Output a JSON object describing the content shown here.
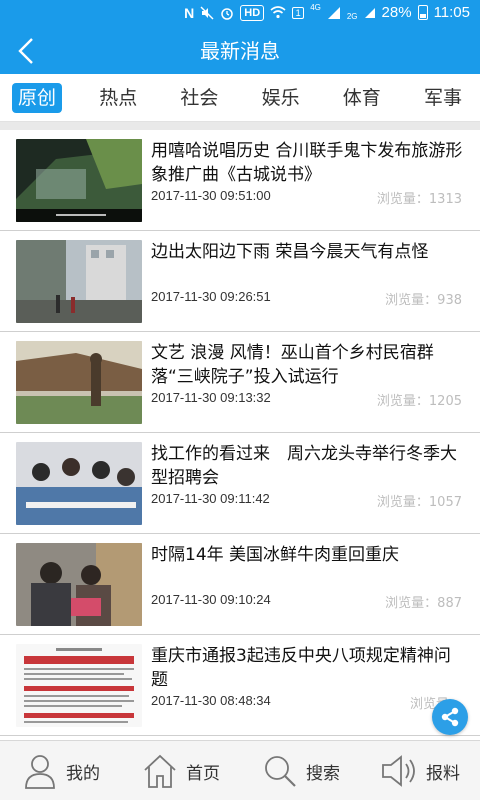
{
  "status_bar": {
    "hd_label": "HD",
    "sim_label": "1",
    "network_4g": "4G",
    "network_2g": "2G",
    "battery_percent": "28%",
    "time": "11:05"
  },
  "header": {
    "title": "最新消息",
    "back_icon": "chevron-left-icon"
  },
  "tabs": [
    {
      "label": "原创",
      "active": true
    },
    {
      "label": "热点",
      "active": false
    },
    {
      "label": "社会",
      "active": false
    },
    {
      "label": "娱乐",
      "active": false
    },
    {
      "label": "体育",
      "active": false
    },
    {
      "label": "军事",
      "active": false
    }
  ],
  "news": [
    {
      "title": "用嘻哈说唱历史 合川联手鬼卞发布旅游形象推广曲《古城说书》",
      "date": "2017-11-30 09:51:00",
      "views": "浏览量：1313"
    },
    {
      "title": "边出太阳边下雨 荣昌今晨天气有点怪",
      "date": "2017-11-30 09:26:51",
      "views": "浏览量：938"
    },
    {
      "title": "文艺 浪漫 风情！巫山首个乡村民宿群落“三峡院子”投入试运行",
      "date": "2017-11-30 09:13:32",
      "views": "浏览量：1205"
    },
    {
      "title": "找工作的看过来　周六龙头寺举行冬季大型招聘会",
      "date": "2017-11-30 09:11:42",
      "views": "浏览量：1057"
    },
    {
      "title": "时隔14年 美国冰鲜牛肉重回重庆",
      "date": "2017-11-30 09:10:24",
      "views": "浏览量：887"
    },
    {
      "title": "重庆市通报3起违反中央八项规定精神问题",
      "date": "2017-11-30 08:48:34",
      "views": "浏览量："
    }
  ],
  "bottom_nav": [
    {
      "label": "我的",
      "icon": "user-icon"
    },
    {
      "label": "首页",
      "icon": "home-icon"
    },
    {
      "label": "搜索",
      "icon": "search-icon"
    },
    {
      "label": "报料",
      "icon": "speaker-icon"
    }
  ],
  "colors": {
    "accent": "#1a9bea",
    "text": "#111111",
    "muted": "#bdbdbd",
    "nav_bg": "#f5f5f5"
  }
}
